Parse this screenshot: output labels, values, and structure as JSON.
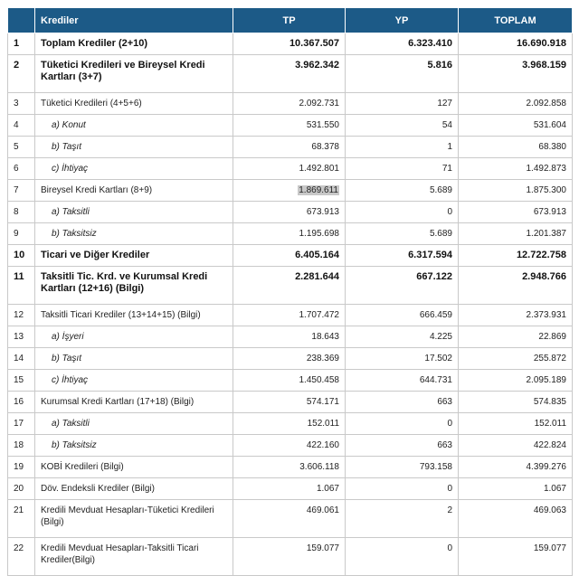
{
  "headers": {
    "num": "",
    "label": "Krediler",
    "tp": "TP",
    "yp": "YP",
    "toplam": "TOPLAM"
  },
  "rows": [
    {
      "num": "1",
      "label": "Toplam Krediler (2+10)",
      "tp": "10.367.507",
      "yp": "6.323.410",
      "toplam": "16.690.918",
      "bold": true,
      "sub": false,
      "tall": false
    },
    {
      "num": "2",
      "label": "Tüketici Kredileri ve Bireysel Kredi Kartları (3+7)",
      "tp": "3.962.342",
      "yp": "5.816",
      "toplam": "3.968.159",
      "bold": true,
      "sub": false,
      "tall": true
    },
    {
      "num": "3",
      "label": "Tüketici Kredileri (4+5+6)",
      "tp": "2.092.731",
      "yp": "127",
      "toplam": "2.092.858",
      "bold": false,
      "sub": false,
      "tall": false
    },
    {
      "num": "4",
      "label": "a) Konut",
      "tp": "531.550",
      "yp": "54",
      "toplam": "531.604",
      "bold": false,
      "sub": true,
      "tall": false
    },
    {
      "num": "5",
      "label": "b) Taşıt",
      "tp": "68.378",
      "yp": "1",
      "toplam": "68.380",
      "bold": false,
      "sub": true,
      "tall": false
    },
    {
      "num": "6",
      "label": "c) İhtiyaç",
      "tp": "1.492.801",
      "yp": "71",
      "toplam": "1.492.873",
      "bold": false,
      "sub": true,
      "tall": false
    },
    {
      "num": "7",
      "label": "Bireysel Kredi Kartları (8+9)",
      "tp": "1.869.611",
      "yp": "5.689",
      "toplam": "1.875.300",
      "bold": false,
      "sub": false,
      "tall": false,
      "highlight_tp": true
    },
    {
      "num": "8",
      "label": "a) Taksitli",
      "tp": "673.913",
      "yp": "0",
      "toplam": "673.913",
      "bold": false,
      "sub": true,
      "tall": false
    },
    {
      "num": "9",
      "label": "b) Taksitsiz",
      "tp": "1.195.698",
      "yp": "5.689",
      "toplam": "1.201.387",
      "bold": false,
      "sub": true,
      "tall": false
    },
    {
      "num": "10",
      "label": "Ticari ve Diğer Krediler",
      "tp": "6.405.164",
      "yp": "6.317.594",
      "toplam": "12.722.758",
      "bold": true,
      "sub": false,
      "tall": false
    },
    {
      "num": "11",
      "label": "Taksitli Tic. Krd. ve Kurumsal Kredi Kartları (12+16) (Bilgi)",
      "tp": "2.281.644",
      "yp": "667.122",
      "toplam": "2.948.766",
      "bold": true,
      "sub": false,
      "tall": true
    },
    {
      "num": "12",
      "label": "Taksitli Ticari Krediler (13+14+15) (Bilgi)",
      "tp": "1.707.472",
      "yp": "666.459",
      "toplam": "2.373.931",
      "bold": false,
      "sub": false,
      "tall": false
    },
    {
      "num": "13",
      "label": "a) İşyeri",
      "tp": "18.643",
      "yp": "4.225",
      "toplam": "22.869",
      "bold": false,
      "sub": true,
      "tall": false
    },
    {
      "num": "14",
      "label": "b) Taşıt",
      "tp": "238.369",
      "yp": "17.502",
      "toplam": "255.872",
      "bold": false,
      "sub": true,
      "tall": false
    },
    {
      "num": "15",
      "label": "c) İhtiyaç",
      "tp": "1.450.458",
      "yp": "644.731",
      "toplam": "2.095.189",
      "bold": false,
      "sub": true,
      "tall": false
    },
    {
      "num": "16",
      "label": "Kurumsal Kredi Kartları (17+18) (Bilgi)",
      "tp": "574.171",
      "yp": "663",
      "toplam": "574.835",
      "bold": false,
      "sub": false,
      "tall": false
    },
    {
      "num": "17",
      "label": "a) Taksitli",
      "tp": "152.011",
      "yp": "0",
      "toplam": "152.011",
      "bold": false,
      "sub": true,
      "tall": false
    },
    {
      "num": "18",
      "label": "b) Taksitsiz",
      "tp": "422.160",
      "yp": "663",
      "toplam": "422.824",
      "bold": false,
      "sub": true,
      "tall": false
    },
    {
      "num": "19",
      "label": "KOBİ Kredileri (Bilgi)",
      "tp": "3.606.118",
      "yp": "793.158",
      "toplam": "4.399.276",
      "bold": false,
      "sub": false,
      "tall": false
    },
    {
      "num": "20",
      "label": "Döv. Endeksli Krediler (Bilgi)",
      "tp": "1.067",
      "yp": "0",
      "toplam": "1.067",
      "bold": false,
      "sub": false,
      "tall": false
    },
    {
      "num": "21",
      "label": "Kredili Mevduat Hesapları-Tüketici Kredileri (Bilgi)",
      "tp": "469.061",
      "yp": "2",
      "toplam": "469.063",
      "bold": false,
      "sub": false,
      "tall": true
    },
    {
      "num": "22",
      "label": "Kredili Mevduat Hesapları-Taksitli Ticari Krediler(Bilgi)",
      "tp": "159.077",
      "yp": "0",
      "toplam": "159.077",
      "bold": false,
      "sub": false,
      "tall": true
    }
  ]
}
